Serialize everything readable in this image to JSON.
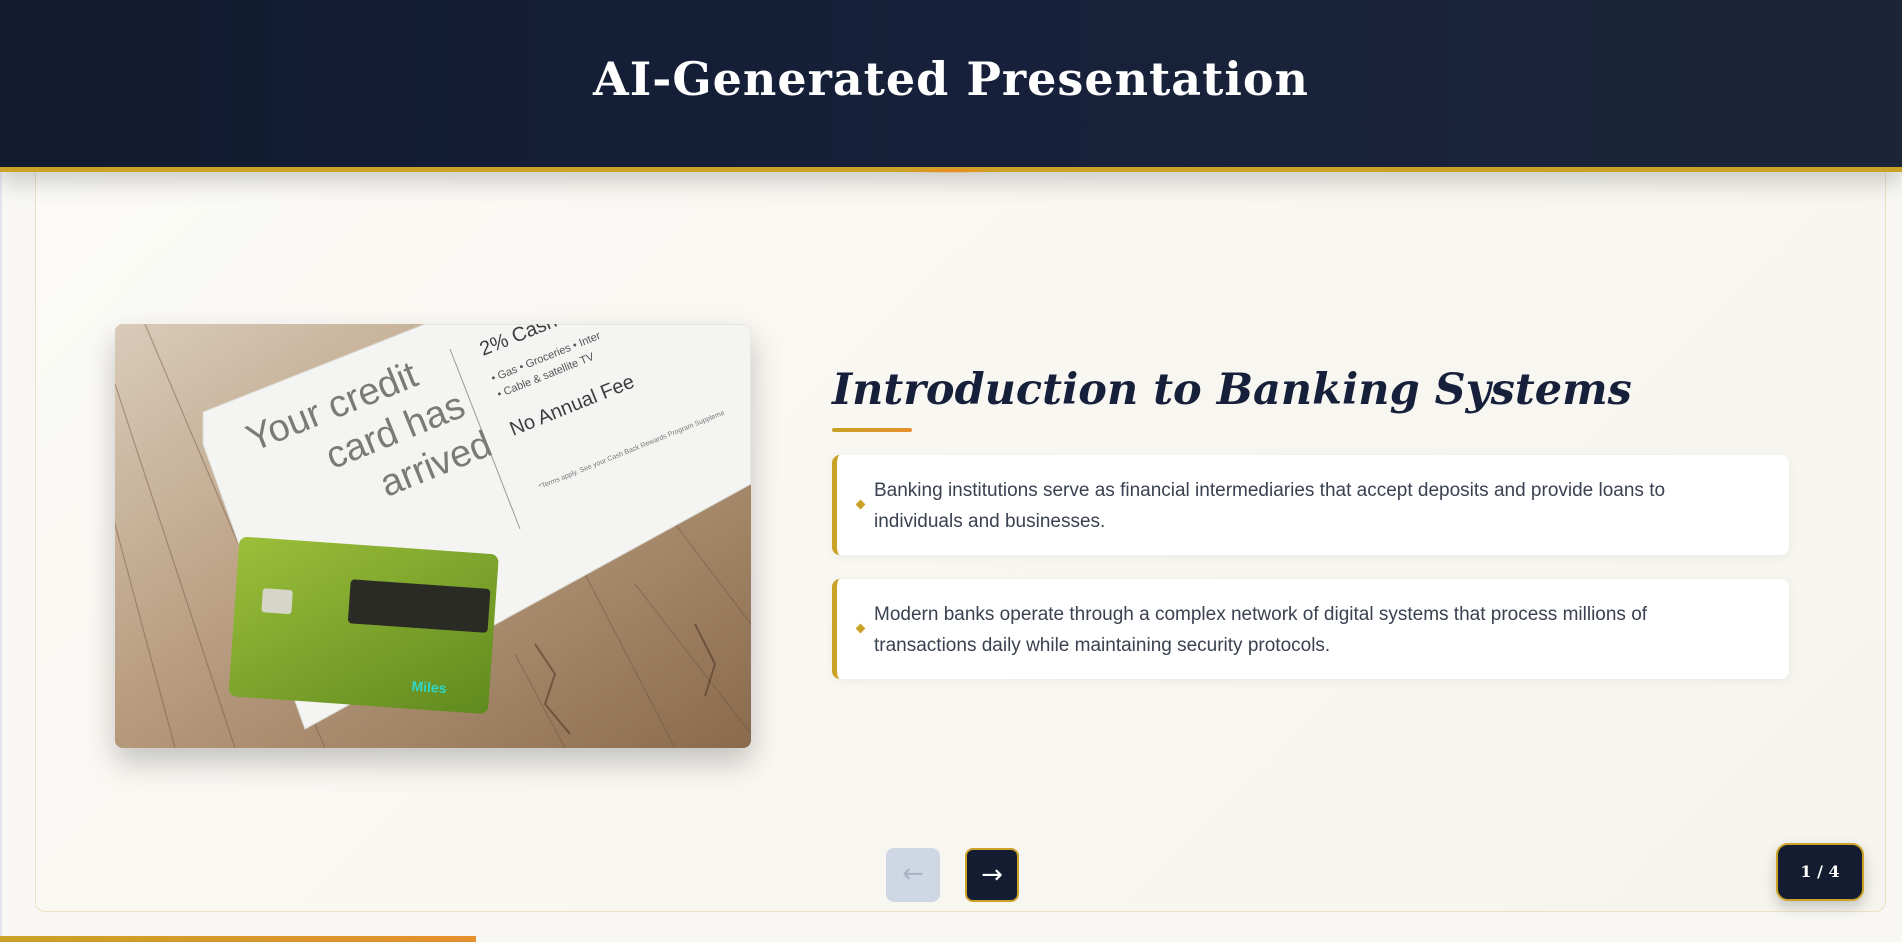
{
  "header": {
    "title": "AI-Generated Presentation"
  },
  "slide": {
    "title": "Introduction to Banking Systems",
    "bullets": [
      "Banking institutions serve as financial intermediaries that accept deposits and provide loans to individuals and businesses.",
      "Modern banks operate through a complex network of digital systems that process millions of transactions daily while maintaining security protocols."
    ],
    "image": {
      "subject": "credit card mailer with green credit card on wooden table",
      "mailer_headline": "Your credit card has arrived",
      "mailer_offer": "2% Cash",
      "mailer_categories": [
        "Gas",
        "Groceries",
        "Cable & satellite TV",
        "Inter"
      ],
      "mailer_fee": "No Annual Fee",
      "mailer_terms": "*Terms apply. See your Cash Back Rewards Program Suppleme",
      "card_brand": "Miles"
    }
  },
  "navigation": {
    "prev_label": "←",
    "next_label": "→",
    "prev_enabled": false,
    "next_enabled": true
  },
  "counter": {
    "label": "1 / 4",
    "current": 1,
    "total": 4
  },
  "progress": {
    "fraction": 0.25
  },
  "colors": {
    "header_bg": "#141c31",
    "accent_gold": "#c9a227",
    "accent_orange": "#e6902e",
    "title_text": "#16203a",
    "body_text": "#3a4150",
    "slide_bg": "#f8f7f3"
  }
}
